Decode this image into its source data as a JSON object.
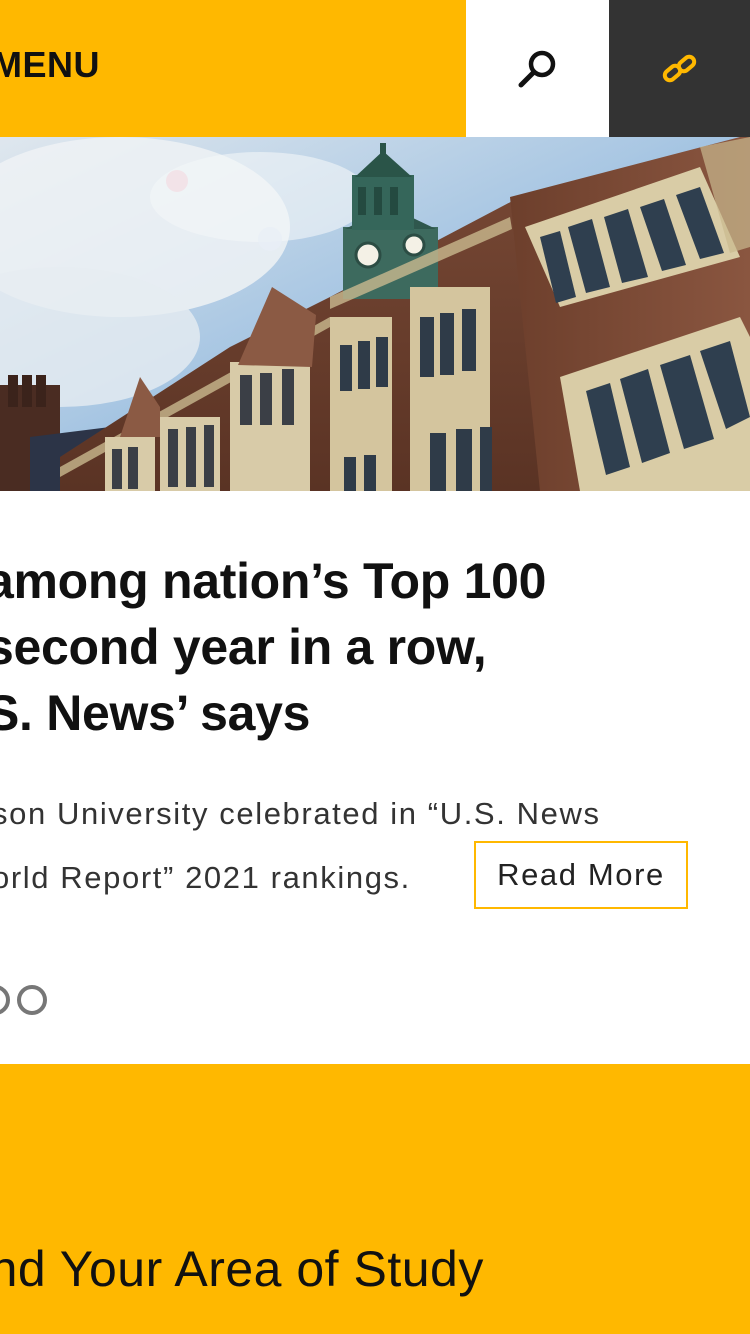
{
  "header": {
    "menu_label": "MENU",
    "icons": {
      "search": "search-icon",
      "link": "link-icon"
    },
    "colors": {
      "accent": "#FFB800",
      "dark": "#333333"
    }
  },
  "hero": {
    "image": "campus-building-clock-tower"
  },
  "article": {
    "headline_lines": [
      "among nation’s Top 100",
      "second year in a row,",
      "S. News’ says"
    ],
    "summary_lines": [
      "son University celebrated in “U.S. News",
      "orld Report” 2021 rankings."
    ],
    "read_more_label": "Read More"
  },
  "carousel": {
    "dot_count_visible": 2,
    "active_index": 0
  },
  "study": {
    "title": "ind Your Area of Study"
  }
}
